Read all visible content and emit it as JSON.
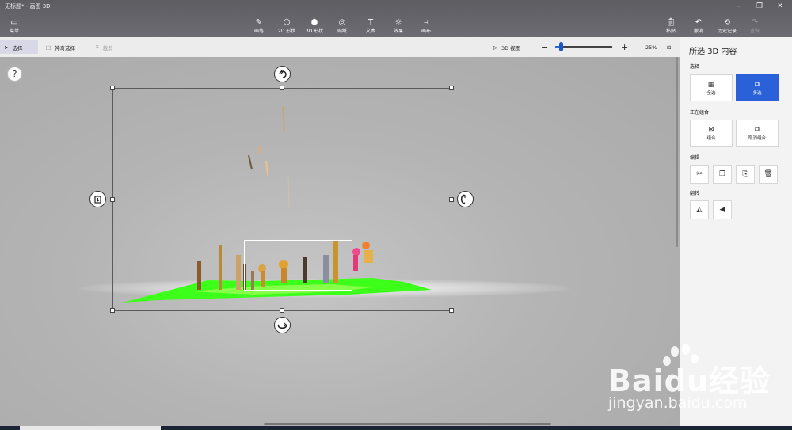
{
  "window": {
    "title": "无标题* - 画图 3D"
  },
  "toolbar": {
    "menu": "菜单",
    "tools": [
      {
        "label": "画笔",
        "icon": "brush-icon"
      },
      {
        "label": "2D 形状",
        "icon": "2d-shapes-icon"
      },
      {
        "label": "3D 形状",
        "icon": "3d-shapes-icon"
      },
      {
        "label": "贴纸",
        "icon": "stickers-icon"
      },
      {
        "label": "文本",
        "icon": "text-icon"
      },
      {
        "label": "效果",
        "icon": "effects-icon"
      },
      {
        "label": "画布",
        "icon": "canvas-icon"
      }
    ],
    "paste": "粘贴",
    "undo": "撤消",
    "history": "历史记录",
    "redo": "重做"
  },
  "subbar": {
    "select": "选择",
    "magic_select": "神奇选择",
    "crop": "裁剪",
    "view_3d": "3D 视图",
    "zoom": "25%",
    "zoom_fraction": 0.1
  },
  "panel": {
    "title": "所选 3D 内容",
    "select_section": "选择",
    "select_all": "全选",
    "multi_select": "多选",
    "group_section": "正在组合",
    "group": "组合",
    "ungroup": "取消组合",
    "edit_section": "编辑",
    "flip_section": "翻转"
  },
  "canvas": {
    "help": "?"
  },
  "watermark": {
    "line1": "Baidu经验",
    "line2": "jingyan.baidu.com"
  },
  "colors": {
    "accent": "#2b61d8",
    "toolbar": "#5d5d62",
    "grass": "#3cff1a"
  }
}
